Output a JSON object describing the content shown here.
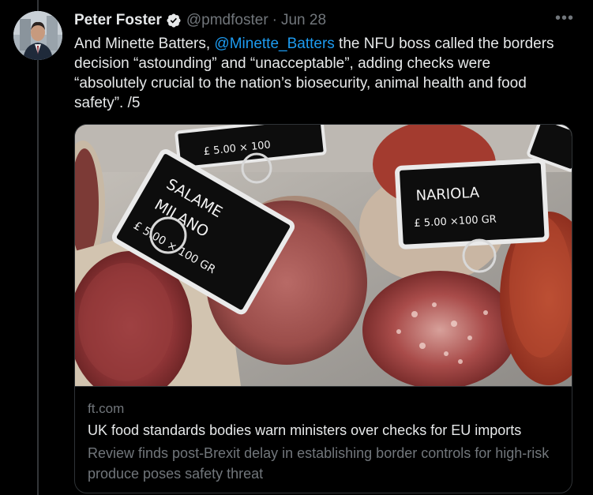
{
  "tweet": {
    "author_name": "Peter Foster",
    "handle": "@pmdfoster",
    "separator": "·",
    "date": "Jun 28",
    "more_label": "•••",
    "text_before": "And Minette Batters, ",
    "mention": "@Minette_Batters",
    "text_after": " the NFU boss called the borders decision “astounding” and “unacceptable”, adding checks were “absolutely crucial to the nation’s biosecurity, animal health and food safety”. /5"
  },
  "card": {
    "domain": "ft.com",
    "title": "UK food standards bodies warn ministers over checks for EU imports",
    "description": "Review finds post-Brexit delay in establishing border controls for high-risk produce poses safety threat",
    "image": {
      "label_left_line1": "SALAME",
      "label_left_line2": "MILANO",
      "label_left_price": "£ 5.00 × 100 GR",
      "label_right_line1": "NARIOLA",
      "label_right_price": "£ 5.00 ×100 GR",
      "label_top_price": "£ 5.00 × 100"
    }
  },
  "colors": {
    "background": "#000000",
    "text": "#e7e9ea",
    "secondary": "#71767b",
    "link": "#1d9bf0",
    "border": "#2f3336"
  }
}
